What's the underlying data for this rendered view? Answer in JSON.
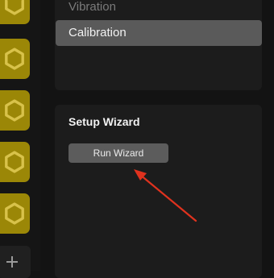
{
  "sidebar": {
    "tiles": [
      {
        "icon": "hexagon-icon"
      },
      {
        "icon": "hexagon-icon"
      },
      {
        "icon": "hexagon-icon"
      },
      {
        "icon": "hexagon-icon"
      },
      {
        "icon": "hexagon-icon"
      }
    ],
    "add_icon": "plus-icon",
    "accent_color": "#9b8707"
  },
  "menu": {
    "items": [
      {
        "label": "Vibration",
        "selected": false
      },
      {
        "label": "Calibration",
        "selected": true
      }
    ]
  },
  "wizard": {
    "title": "Setup Wizard",
    "button_label": "Run Wizard"
  },
  "annotation": {
    "arrow_color": "#e0321e"
  }
}
